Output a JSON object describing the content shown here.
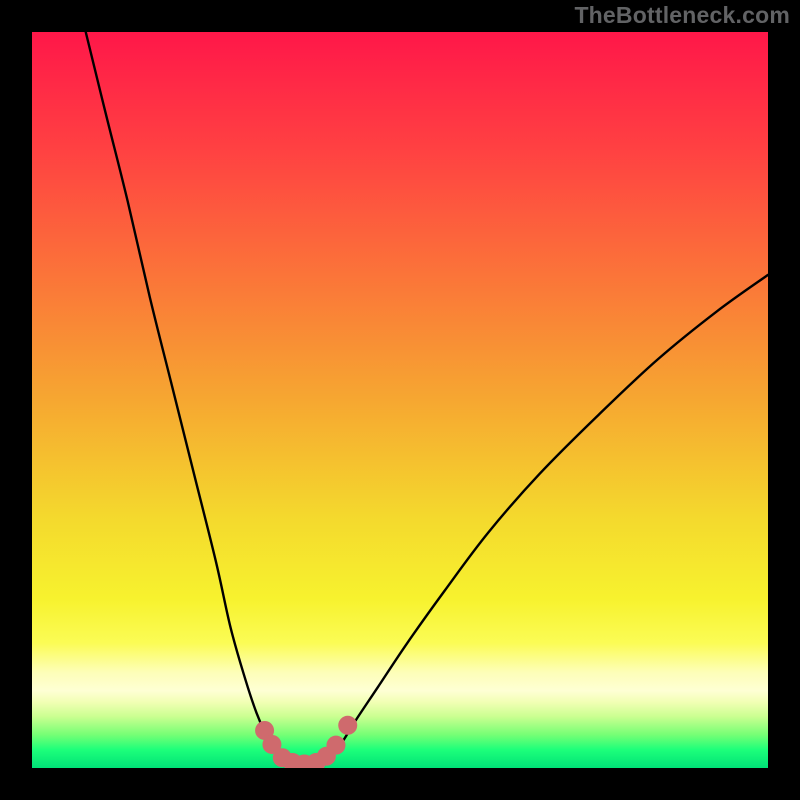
{
  "watermark": "TheBottleneck.com",
  "colors": {
    "frame": "#000000",
    "curve": "#000000",
    "marker": "#cf6a6d",
    "gradient_stops": [
      {
        "offset": 0.0,
        "color": "#ff1749"
      },
      {
        "offset": 0.16,
        "color": "#ff4142"
      },
      {
        "offset": 0.33,
        "color": "#fb7439"
      },
      {
        "offset": 0.5,
        "color": "#f6a731"
      },
      {
        "offset": 0.66,
        "color": "#f4d92d"
      },
      {
        "offset": 0.77,
        "color": "#f7f22e"
      },
      {
        "offset": 0.83,
        "color": "#fbfc55"
      },
      {
        "offset": 0.87,
        "color": "#fdfeb8"
      },
      {
        "offset": 0.895,
        "color": "#feffd4"
      },
      {
        "offset": 0.91,
        "color": "#f2ffb5"
      },
      {
        "offset": 0.93,
        "color": "#cbff91"
      },
      {
        "offset": 0.955,
        "color": "#75ff75"
      },
      {
        "offset": 0.975,
        "color": "#1dff7a"
      },
      {
        "offset": 1.0,
        "color": "#00e277"
      }
    ]
  },
  "chart_data": {
    "type": "line",
    "title": "",
    "xlabel": "",
    "ylabel": "",
    "xlim": [
      0,
      100
    ],
    "ylim": [
      0,
      100
    ],
    "grid": false,
    "series": [
      {
        "name": "left-curve",
        "x": [
          7.3,
          10,
          13,
          16,
          19,
          22,
          25,
          27,
          29,
          30.5,
          31.8,
          33,
          34,
          34.7
        ],
        "y": [
          100,
          89,
          77,
          64,
          52,
          40,
          28,
          19,
          12,
          7.5,
          4.5,
          2.5,
          1.3,
          0.8
        ]
      },
      {
        "name": "right-curve",
        "x": [
          39.6,
          40.5,
          42,
          44,
          47,
          51,
          56,
          62,
          69,
          77,
          85,
          93,
          100
        ],
        "y": [
          0.8,
          1.6,
          3.3,
          6.5,
          11,
          17,
          24,
          32,
          40,
          48,
          55.5,
          62,
          67
        ]
      },
      {
        "name": "valley-floor",
        "x": [
          34.7,
          36,
          37.3,
          38.5,
          39.6
        ],
        "y": [
          0.8,
          0.5,
          0.45,
          0.5,
          0.8
        ]
      }
    ],
    "markers": [
      {
        "x": 31.6,
        "y": 5.1
      },
      {
        "x": 32.6,
        "y": 3.2
      },
      {
        "x": 34.0,
        "y": 1.4
      },
      {
        "x": 35.4,
        "y": 0.75
      },
      {
        "x": 37.0,
        "y": 0.55
      },
      {
        "x": 38.6,
        "y": 0.75
      },
      {
        "x": 40.0,
        "y": 1.6
      },
      {
        "x": 41.3,
        "y": 3.1
      },
      {
        "x": 42.9,
        "y": 5.8
      }
    ],
    "marker_radius_px": 9.5
  }
}
